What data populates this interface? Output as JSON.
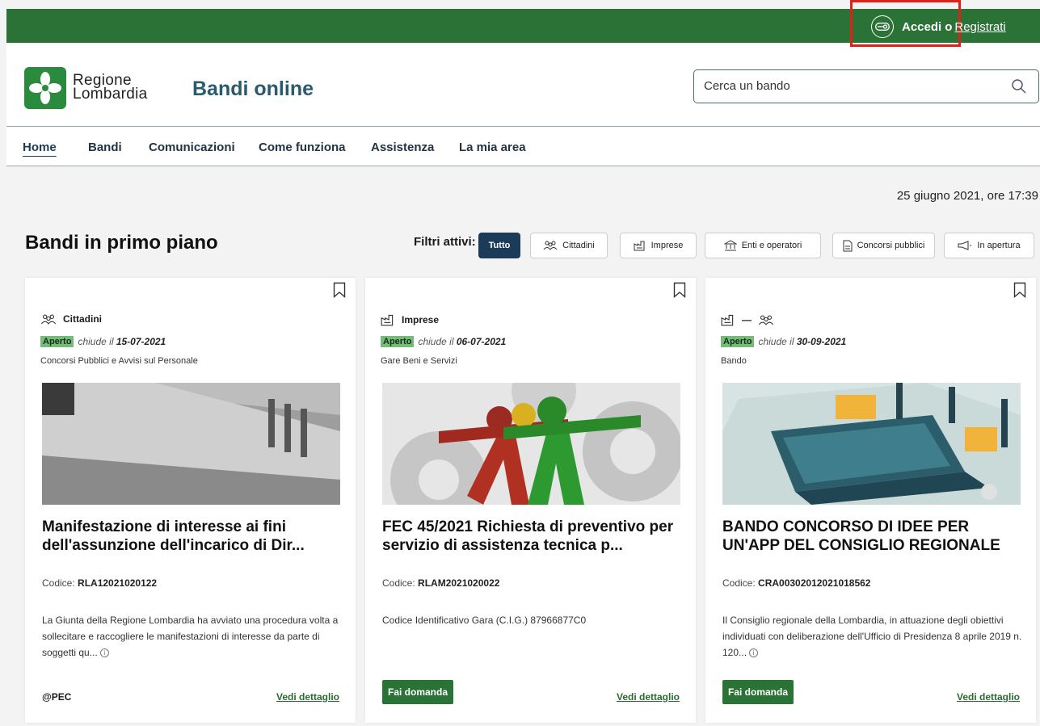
{
  "topbar": {
    "login_label": "Accedi",
    "separator": "o",
    "register_label": "Registrati"
  },
  "header": {
    "logo_line1": "Regione",
    "logo_line2": "Lombardia",
    "site_title": "Bandi online",
    "search_placeholder": "Cerca un bando"
  },
  "nav": {
    "items": [
      {
        "label": "Home"
      },
      {
        "label": "Bandi"
      },
      {
        "label": "Comunicazioni"
      },
      {
        "label": "Come funziona"
      },
      {
        "label": "Assistenza"
      },
      {
        "label": "La mia area"
      }
    ],
    "active": "Home"
  },
  "date": "25 giugno 2021, ore 17:39",
  "section_title": "Bandi in primo piano",
  "filters": {
    "label": "Filtri attivi:",
    "chips": [
      {
        "label": "Tutto",
        "icon": "none"
      },
      {
        "label": "Cittadini",
        "icon": "people-icon"
      },
      {
        "label": "Imprese",
        "icon": "factory-icon"
      },
      {
        "label": "Enti e operatori",
        "icon": "building-icon"
      },
      {
        "label": "Concorsi pubblici",
        "icon": "document-icon"
      },
      {
        "label": "In apertura",
        "icon": "megaphone-icon"
      }
    ]
  },
  "cards": [
    {
      "category": "Cittadini",
      "status": "Aperto",
      "closes_prefix": "chiude il",
      "closes_date": "15-07-2021",
      "subcategory": "Concorsi Pubblici e Avvisi sul Personale",
      "title": "Manifestazione di interesse ai fini dell'assunzione dell'incarico di Dir...",
      "codice_label": "Codice:",
      "codice": "RLA12021020122",
      "description": "La Giunta della Regione Lombardia ha avviato una procedura volta a sollecitare e raccogliere le manifestazioni di interesse da parte di soggetti qu...",
      "footer_left": "@PEC",
      "detail_label": "Vedi dettaglio"
    },
    {
      "category": "Imprese",
      "status": "Aperto",
      "closes_prefix": "chiude il",
      "closes_date": "06-07-2021",
      "subcategory": "Gare Beni e Servizi",
      "title": "FEC 45/2021 Richiesta di preventivo per servizio di assistenza tecnica p...",
      "codice_label": "Codice:",
      "codice": "RLAM2021020022",
      "description": "Codice Identificativo Gara (C.I.G.) 87966877C0",
      "footer_left": "Fai domanda",
      "detail_label": "Vedi dettaglio"
    },
    {
      "category": "—",
      "status": "Aperto",
      "closes_prefix": "chiude il",
      "closes_date": "30-09-2021",
      "subcategory": "Bando",
      "title": "BANDO CONCORSO DI IDEE PER UN'APP DEL CONSIGLIO REGIONALE",
      "codice_label": "Codice:",
      "codice": "CRA00302012021018562",
      "description": "Il Consiglio regionale della Lombardia, in attuazione degli obiettivi individuati con deliberazione dell'Ufficio di Presidenza 8 aprile 2019 n. 120...",
      "footer_left": "Fai domanda",
      "detail_label": "Vedi dettaglio"
    }
  ],
  "colors": {
    "brand_green": "#2a7235",
    "highlight_red": "#e0211a",
    "nav_dark": "#1b3b58",
    "badge_green": "#78b97c"
  }
}
